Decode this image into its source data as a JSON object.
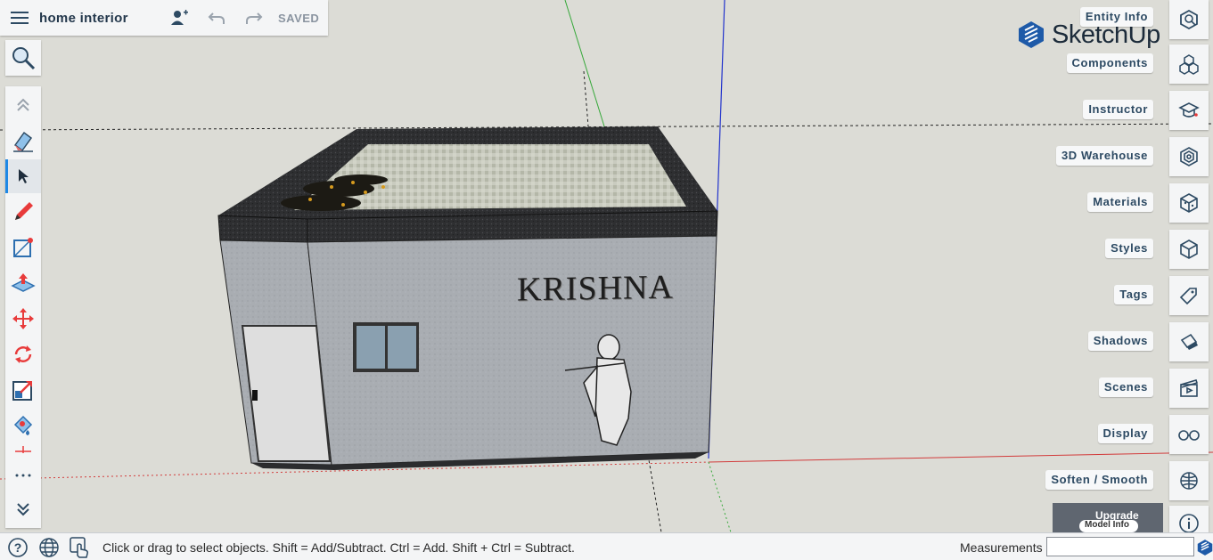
{
  "topbar": {
    "title": "home interior",
    "saved": "SAVED"
  },
  "viewport": {
    "wall_text": "KRISHNA"
  },
  "logo": {
    "text": "SketchUp"
  },
  "panel": {
    "items": [
      {
        "label": "Entity Info",
        "icon": "entity-info-icon"
      },
      {
        "label": "Components",
        "icon": "components-icon"
      },
      {
        "label": "Instructor",
        "icon": "instructor-icon"
      },
      {
        "label": "3D Warehouse",
        "icon": "3d-warehouse-icon"
      },
      {
        "label": "Materials",
        "icon": "materials-icon"
      },
      {
        "label": "Styles",
        "icon": "styles-icon"
      },
      {
        "label": "Tags",
        "icon": "tags-icon"
      },
      {
        "label": "Shadows",
        "icon": "shadows-icon"
      },
      {
        "label": "Scenes",
        "icon": "scenes-icon"
      },
      {
        "label": "Display",
        "icon": "display-icon"
      },
      {
        "label": "Soften / Smooth",
        "icon": "soften-smooth-icon"
      }
    ],
    "upgrade": "Upgrade Now",
    "upgrade_sub": "Model Info"
  },
  "toolbar": {
    "tools": [
      "collapse-up",
      "eraser",
      "select",
      "pencil",
      "rectangle",
      "push-pull",
      "move",
      "rotate",
      "scale",
      "paint-bucket",
      "more",
      "expand-down"
    ],
    "active": "select"
  },
  "statusbar": {
    "hint": "Click or drag to select objects. Shift = Add/Subtract. Ctrl = Add. Shift + Ctrl = Subtract.",
    "measurements_label": "Measurements",
    "measurements_value": ""
  },
  "colors": {
    "accent": "#1e88e5",
    "axis_red": "#d23b3b",
    "axis_green": "#36a83a",
    "axis_blue": "#2233cc"
  }
}
